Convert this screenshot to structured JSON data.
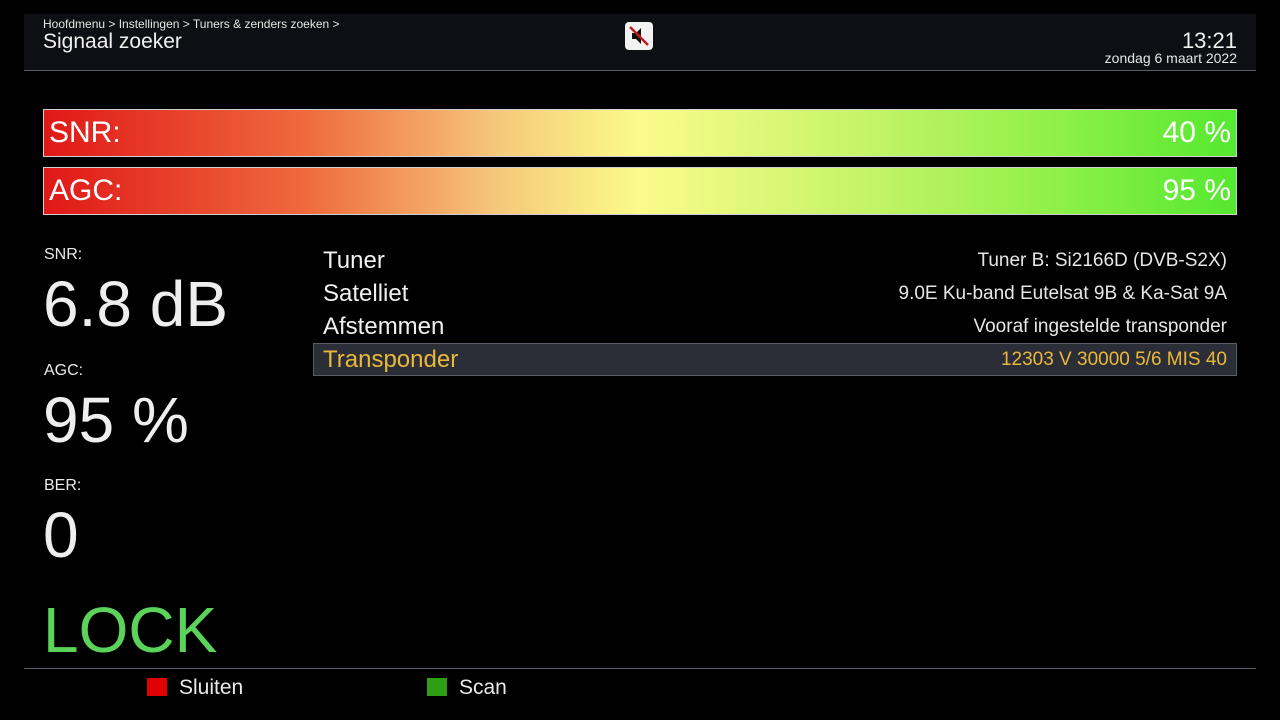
{
  "header": {
    "breadcrumb": "Hoofdmenu > Instellingen > Tuners & zenders zoeken >",
    "title": "Signaal zoeker",
    "time": "13:21",
    "date": "zondag  6 maart 2022",
    "mute_icon": "mute-icon"
  },
  "bars": {
    "snr": {
      "label": "SNR:",
      "value_text": "40 %",
      "level": 0.4
    },
    "agc": {
      "label": "AGC:",
      "value_text": "95 %",
      "level": 0.95
    }
  },
  "readouts": {
    "snr": {
      "label": "SNR:",
      "value": "6.8 dB"
    },
    "agc": {
      "label": "AGC:",
      "value": "95 %"
    },
    "ber": {
      "label": "BER:",
      "value": "0"
    },
    "status": "LOCK"
  },
  "settings": [
    {
      "label": "Tuner",
      "value": "Tuner B: Si2166D (DVB-S2X)"
    },
    {
      "label": "Satelliet",
      "value": "9.0E Ku-band Eutelsat 9B & Ka-Sat 9A"
    },
    {
      "label": "Afstemmen",
      "value": "Vooraf ingestelde transponder"
    },
    {
      "label": "Transponder",
      "value": "12303 V 30000 5/6 MIS 40",
      "selected": true
    }
  ],
  "footer": {
    "red_label": "Sluiten",
    "green_label": "Scan"
  },
  "colors": {
    "background": "#000000",
    "selected_text": "#e9b83a",
    "lock": "#5bd35b",
    "red_key": "#e00000",
    "green_key": "#2e9e12"
  }
}
